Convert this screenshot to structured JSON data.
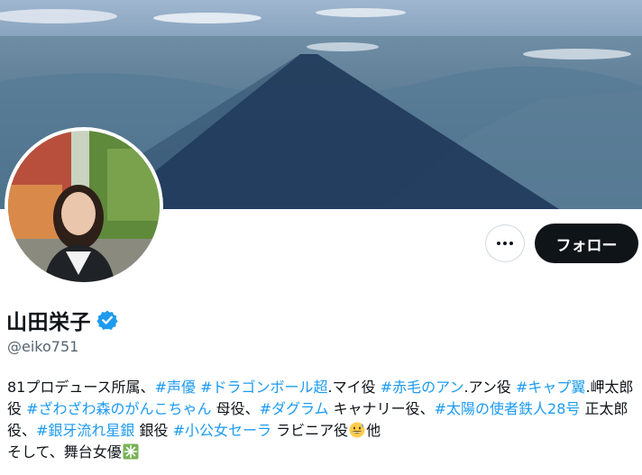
{
  "profile": {
    "display_name": "山田栄子",
    "handle": "@eiko751",
    "verified_icon": "verified-badge-icon",
    "banner_icon": "mountain-shadow-photo",
    "avatar_icon": "profile-photo"
  },
  "actions": {
    "more_icon": "more-dots-icon",
    "follow_label": "フォロー"
  },
  "bio": {
    "segments": [
      {
        "text": "81プロデュース所属、",
        "tag": false
      },
      {
        "text": "#声優",
        "tag": true
      },
      {
        "text": " ",
        "tag": false
      },
      {
        "text": "#ドラゴンボール超",
        "tag": true
      },
      {
        "text": ".マイ役 ",
        "tag": false
      },
      {
        "text": "#赤毛のアン",
        "tag": true
      },
      {
        "text": ".アン役 ",
        "tag": false
      },
      {
        "text": "#キャプ翼",
        "tag": true
      },
      {
        "text": ".岬太郎役 ",
        "tag": false
      },
      {
        "text": "#ざわざわ森のがんこちゃん",
        "tag": true
      },
      {
        "text": " 母役、",
        "tag": false
      },
      {
        "text": "#ダグラム",
        "tag": true
      },
      {
        "text": " キャナリー役、",
        "tag": false
      },
      {
        "text": "#太陽の使者鉄人28号",
        "tag": true
      },
      {
        "text": " 正太郎役、",
        "tag": false
      },
      {
        "text": "#銀牙流れ星銀",
        "tag": true
      },
      {
        "text": " 銀役 ",
        "tag": false
      },
      {
        "text": "#小公女セーラ",
        "tag": true
      },
      {
        "text": " ラビニア役",
        "tag": false
      }
    ],
    "emoji_sweat": "grinning-sweat-emoji",
    "after_emoji": "他",
    "line2": "そして、舞台女優",
    "emoji_sparkle": "sparkle-emoji"
  }
}
